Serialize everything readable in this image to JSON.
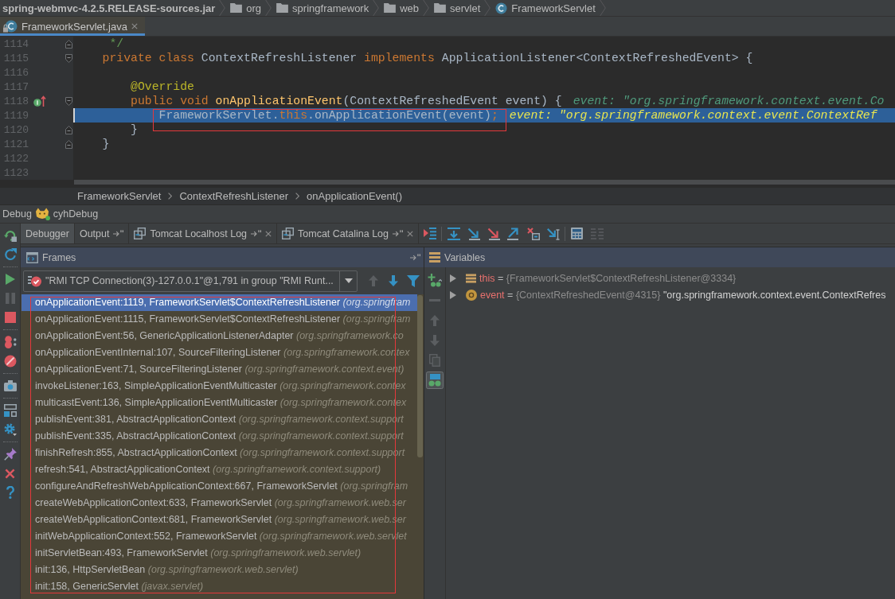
{
  "navigation_bar": [
    {
      "label": "spring-webmvc-4.2.5.RELEASE-sources.jar",
      "kind": "archive"
    },
    {
      "label": "org",
      "kind": "folder"
    },
    {
      "label": "springframework",
      "kind": "folder"
    },
    {
      "label": "web",
      "kind": "folder"
    },
    {
      "label": "servlet",
      "kind": "folder"
    },
    {
      "label": "FrameworkServlet",
      "kind": "class"
    }
  ],
  "editor_tabs": [
    {
      "label": "FrameworkServlet.java",
      "selected": true,
      "read_only": true,
      "closable": true
    }
  ],
  "editor": {
    "lines": [
      {
        "number": "1114",
        "fold_open": false,
        "fold_close": true,
        "overrides": false,
        "execution_point": false,
        "caret": false,
        "annotated": false,
        "segments": [
          {
            "text": "     */",
            "kind": "comment"
          }
        ]
      },
      {
        "number": "1115",
        "fold_open": true,
        "fold_close": false,
        "overrides": false,
        "execution_point": false,
        "caret": false,
        "annotated": false,
        "segments": [
          {
            "text": "    private class ",
            "kind": "keyword"
          },
          {
            "text": "ContextRefreshListener ",
            "kind": "plain"
          },
          {
            "text": "implements ",
            "kind": "keyword"
          },
          {
            "text": "ApplicationListener<ContextRefreshedEvent> {",
            "kind": "plain"
          }
        ]
      },
      {
        "number": "1116",
        "fold_open": false,
        "fold_close": false,
        "overrides": false,
        "execution_point": false,
        "caret": false,
        "annotated": false
      },
      {
        "number": "1117",
        "fold_open": false,
        "fold_close": false,
        "overrides": false,
        "execution_point": false,
        "caret": false,
        "annotated": false,
        "segments": [
          {
            "text": "        @Override",
            "kind": "annotation"
          }
        ]
      },
      {
        "number": "1118",
        "fold_open": true,
        "fold_close": false,
        "overrides": true,
        "execution_point": false,
        "caret": false,
        "annotated": false,
        "segments": [
          {
            "text": "        public void ",
            "kind": "keyword"
          },
          {
            "text": "onApplicationEvent",
            "kind": "method"
          },
          {
            "text": "(ContextRefreshedEvent event) {",
            "kind": "plain"
          }
        ],
        "hint": "event: \"org.springframework.context.event.Co"
      },
      {
        "number": "1119",
        "fold_open": false,
        "fold_close": false,
        "overrides": false,
        "execution_point": true,
        "caret": true,
        "annotated": true,
        "segments": [
          {
            "text": "            FrameworkServlet.",
            "kind": "plain"
          },
          {
            "text": "this",
            "kind": "keyword"
          },
          {
            "text": ".onApplicationEvent(event)",
            "kind": "plain"
          },
          {
            "text": ";",
            "kind": "keyword"
          }
        ],
        "hint": "event: \"org.springframework.context.event.ContextRef"
      },
      {
        "number": "1120",
        "fold_open": false,
        "fold_close": true,
        "overrides": false,
        "execution_point": false,
        "caret": false,
        "annotated": false,
        "segments": [
          {
            "text": "        }",
            "kind": "plain"
          }
        ]
      },
      {
        "number": "1121",
        "fold_open": false,
        "fold_close": true,
        "overrides": false,
        "execution_point": false,
        "caret": false,
        "annotated": false,
        "segments": [
          {
            "text": "    }",
            "kind": "plain"
          }
        ]
      },
      {
        "number": "1122",
        "fold_open": false,
        "fold_close": false,
        "overrides": false,
        "execution_point": false,
        "caret": false,
        "annotated": false
      },
      {
        "number": "1123",
        "fold_open": false,
        "fold_close": false,
        "overrides": false,
        "execution_point": false,
        "caret": false,
        "annotated": false
      }
    ],
    "breadcrumbs": [
      "FrameworkServlet",
      "ContextRefreshListener",
      "onApplicationEvent()"
    ]
  },
  "debug": {
    "title": "Debug",
    "configuration": "cyhDebug",
    "side_toolbar": [
      {
        "buttons": [
          {
            "kind": "rerun",
            "disabled": false
          },
          {
            "kind": "restart",
            "disabled": false
          }
        ]
      },
      {
        "buttons": [
          {
            "kind": "resume",
            "disabled": false
          },
          {
            "kind": "pause",
            "disabled": true
          },
          {
            "kind": "stop",
            "disabled": false
          }
        ]
      },
      {
        "buttons": [
          {
            "kind": "breakpoints",
            "disabled": false
          },
          {
            "kind": "mute",
            "disabled": false
          }
        ]
      },
      {
        "buttons": [
          {
            "kind": "dump",
            "disabled": false
          }
        ]
      },
      {
        "buttons": [
          {
            "kind": "layout",
            "disabled": false
          },
          {
            "kind": "settings",
            "disabled": false
          }
        ]
      },
      {
        "buttons": [
          {
            "kind": "pin",
            "disabled": false
          },
          {
            "kind": "close",
            "disabled": false
          },
          {
            "kind": "help",
            "disabled": false
          }
        ]
      }
    ],
    "tabs": [
      {
        "label": "Debugger",
        "kind": "plain",
        "selected": true,
        "pinned": false,
        "closable": false
      },
      {
        "label": "Output",
        "kind": "plain",
        "selected": false,
        "pinned": true,
        "closable": false
      },
      {
        "label": "Tomcat Localhost Log",
        "kind": "log",
        "selected": false,
        "pinned": true,
        "closable": true
      },
      {
        "label": "Tomcat Catalina Log",
        "kind": "log",
        "selected": false,
        "pinned": true,
        "closable": true
      }
    ],
    "step_toolbar": [
      {
        "buttons": [
          {
            "kind": "execution-point",
            "disabled": false
          }
        ]
      },
      {
        "buttons": [
          {
            "kind": "step-over",
            "disabled": false
          },
          {
            "kind": "step-into",
            "disabled": false
          },
          {
            "kind": "force-step-into",
            "disabled": false
          },
          {
            "kind": "step-out",
            "disabled": false
          },
          {
            "kind": "drop-frame",
            "disabled": false
          },
          {
            "kind": "run-to-cursor",
            "disabled": false
          }
        ]
      },
      {
        "buttons": [
          {
            "kind": "evaluate",
            "disabled": false
          },
          {
            "kind": "trace",
            "disabled": true
          }
        ]
      }
    ],
    "frames": {
      "title": "Frames",
      "thread": "\"RMI TCP Connection(3)-127.0.0.1\"@1,791 in group \"RMI Runt...",
      "nav_buttons": [
        {
          "kind": "up",
          "disabled": true
        },
        {
          "kind": "down",
          "disabled": false
        },
        {
          "kind": "filter",
          "disabled": false
        }
      ],
      "annotated": true,
      "items": [
        {
          "method": "onApplicationEvent:1119, FrameworkServlet$ContextRefreshListener",
          "package": "(org.springfram",
          "selected": true
        },
        {
          "method": "onApplicationEvent:1115, FrameworkServlet$ContextRefreshListener",
          "package": "(org.springfram",
          "selected": false
        },
        {
          "method": "onApplicationEvent:56, GenericApplicationListenerAdapter",
          "package": "(org.springframework.co",
          "selected": false
        },
        {
          "method": "onApplicationEventInternal:107, SourceFilteringListener",
          "package": "(org.springframework.contex",
          "selected": false
        },
        {
          "method": "onApplicationEvent:71, SourceFilteringListener",
          "package": "(org.springframework.context.event)",
          "selected": false
        },
        {
          "method": "invokeListener:163, SimpleApplicationEventMulticaster",
          "package": "(org.springframework.contex",
          "selected": false
        },
        {
          "method": "multicastEvent:136, SimpleApplicationEventMulticaster",
          "package": "(org.springframework.contex",
          "selected": false
        },
        {
          "method": "publishEvent:381, AbstractApplicationContext",
          "package": "(org.springframework.context.support",
          "selected": false
        },
        {
          "method": "publishEvent:335, AbstractApplicationContext",
          "package": "(org.springframework.context.support",
          "selected": false
        },
        {
          "method": "finishRefresh:855, AbstractApplicationContext",
          "package": "(org.springframework.context.support",
          "selected": false
        },
        {
          "method": "refresh:541, AbstractApplicationContext",
          "package": "(org.springframework.context.support)",
          "selected": false
        },
        {
          "method": "configureAndRefreshWebApplicationContext:667, FrameworkServlet",
          "package": "(org.springfram",
          "selected": false
        },
        {
          "method": "createWebApplicationContext:633, FrameworkServlet",
          "package": "(org.springframework.web.ser",
          "selected": false
        },
        {
          "method": "createWebApplicationContext:681, FrameworkServlet",
          "package": "(org.springframework.web.ser",
          "selected": false
        },
        {
          "method": "initWebApplicationContext:552, FrameworkServlet",
          "package": "(org.springframework.web.servlet",
          "selected": false
        },
        {
          "method": "initServletBean:493, FrameworkServlet",
          "package": "(org.springframework.web.servlet)",
          "selected": false
        },
        {
          "method": "init:136, HttpServletBean",
          "package": "(org.springframework.web.servlet)",
          "selected": false
        },
        {
          "method": "init:158, GenericServlet",
          "package": "(javax.servlet)",
          "selected": false
        }
      ]
    },
    "variables": {
      "title": "Variables",
      "toolbar": [
        {
          "kind": "add",
          "disabled": false,
          "on": false
        },
        {
          "kind": "remove",
          "disabled": true,
          "on": false
        },
        {
          "kind": "up",
          "disabled": true,
          "on": false
        },
        {
          "kind": "down",
          "disabled": true,
          "on": false
        },
        {
          "kind": "copy",
          "disabled": true,
          "on": false
        },
        {
          "kind": "watches",
          "disabled": false,
          "on": true
        }
      ],
      "items": [
        {
          "name": "this",
          "separator": "=",
          "value": "{FrameworkServlet$ContextRefreshListener@3334}",
          "kind": "field",
          "expanded": false
        },
        {
          "name": "event",
          "separator": "=",
          "value": "{ContextRefreshedEvent@4315}",
          "text": "\"org.springframework.context.event.ContextRefres",
          "kind": "parameter",
          "expanded": false
        }
      ]
    }
  }
}
